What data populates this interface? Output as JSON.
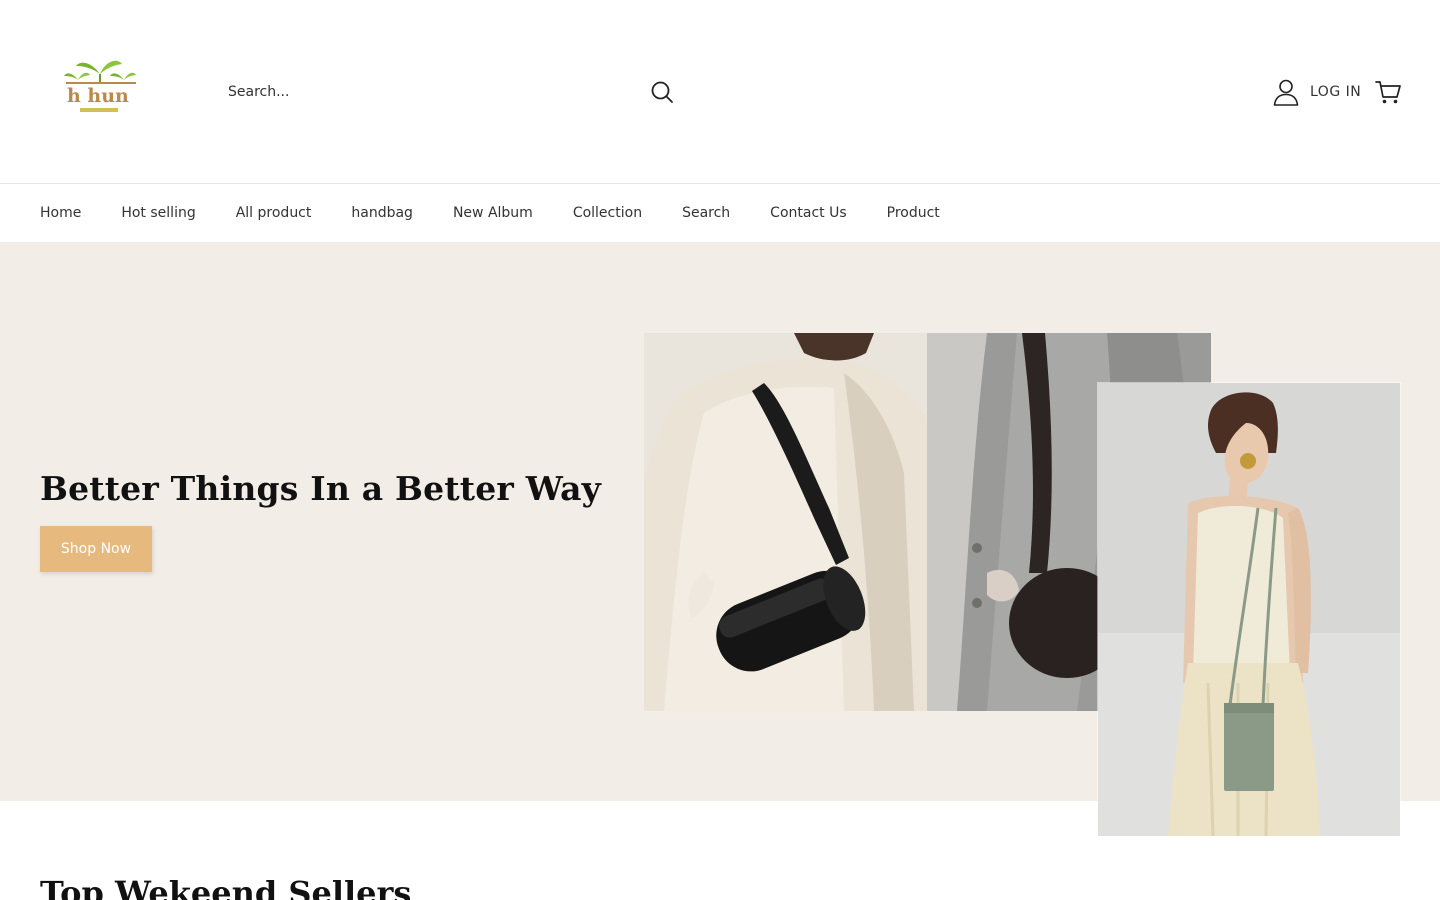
{
  "header": {
    "logo_text": "h hun",
    "search": {
      "placeholder": "Search...",
      "value": ""
    },
    "account_label": "LOG IN"
  },
  "nav": {
    "items": [
      {
        "label": "Home"
      },
      {
        "label": "Hot selling"
      },
      {
        "label": "All product"
      },
      {
        "label": "handbag"
      },
      {
        "label": "New Album"
      },
      {
        "label": "Collection"
      },
      {
        "label": "Search"
      },
      {
        "label": "Contact Us"
      },
      {
        "label": "Product"
      }
    ]
  },
  "hero": {
    "title": "Better Things In a Better Way",
    "button_label": "Shop Now"
  },
  "sections": {
    "top_sellers_title": "Top Wekeend Sellers"
  },
  "colors": {
    "hero_bg": "#f2ede6",
    "button_bg": "#e6b97f",
    "logo_green": "#7ab32e",
    "logo_brown": "#b98a4e"
  },
  "icons": {
    "search": "search-icon",
    "account": "user-icon",
    "cart": "cart-icon"
  }
}
